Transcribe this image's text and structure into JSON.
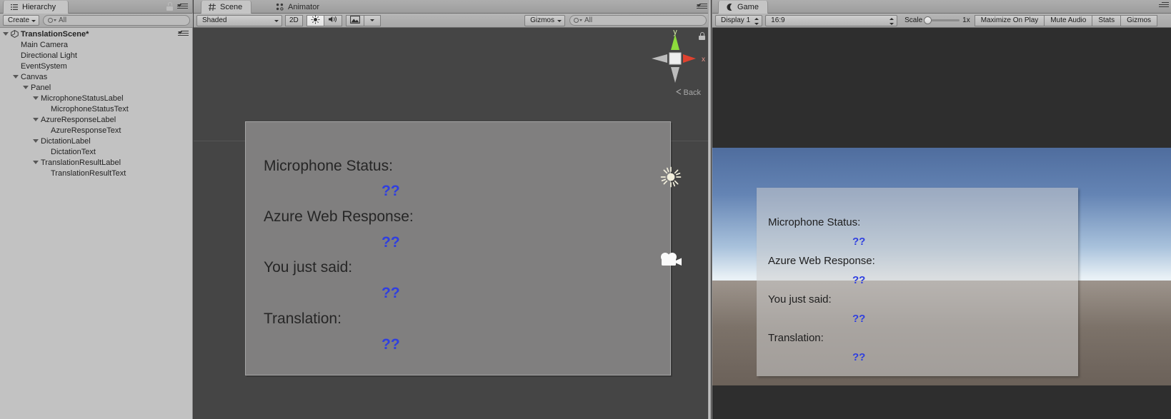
{
  "hierarchy": {
    "tab_label": "Hierarchy",
    "tab_icon": "hierarchy-icon",
    "create_label": "Create",
    "search_placeholder": "All",
    "search_value": "All",
    "scene_root": "TranslationScene*",
    "items": [
      {
        "label": "Main Camera",
        "depth": 1,
        "expandable": false
      },
      {
        "label": "Directional Light",
        "depth": 1,
        "expandable": false
      },
      {
        "label": "EventSystem",
        "depth": 1,
        "expandable": false
      },
      {
        "label": "Canvas",
        "depth": 1,
        "expandable": true
      },
      {
        "label": "Panel",
        "depth": 2,
        "expandable": true
      },
      {
        "label": "MicrophoneStatusLabel",
        "depth": 3,
        "expandable": true
      },
      {
        "label": "MicrophoneStatusText",
        "depth": 4,
        "expandable": false
      },
      {
        "label": "AzureResponseLabel",
        "depth": 3,
        "expandable": true
      },
      {
        "label": "AzureResponseText",
        "depth": 4,
        "expandable": false
      },
      {
        "label": "DictationLabel",
        "depth": 3,
        "expandable": true
      },
      {
        "label": "DictationText",
        "depth": 4,
        "expandable": false
      },
      {
        "label": "TranslationResultLabel",
        "depth": 3,
        "expandable": true
      },
      {
        "label": "TranslationResultText",
        "depth": 4,
        "expandable": false
      }
    ]
  },
  "scene": {
    "tabs": [
      {
        "label": "Scene",
        "active": true,
        "icon": "scene-grid-icon"
      },
      {
        "label": "Animator",
        "active": false,
        "icon": "animator-icon"
      }
    ],
    "toolbar": {
      "shading_mode": "Shaded",
      "mode_2d": "2D",
      "lighting_icon": "sun-icon",
      "audio_icon": "speaker-icon",
      "effects_icon": "image-icon",
      "gizmos_label": "Gizmos",
      "search_placeholder": "All",
      "search_value": "All"
    },
    "axis_gizmo": {
      "y_label": "y",
      "x_label": "x",
      "persp_label": "Back",
      "y_color": "#8ddb3c",
      "x_color": "#e0422f",
      "center_color": "#e8e8e8"
    },
    "panel": {
      "rows": [
        {
          "label": "Microphone Status:",
          "value": "??"
        },
        {
          "label": "Azure Web Response:",
          "value": "??"
        },
        {
          "label": "You just said:",
          "value": "??"
        },
        {
          "label": "Translation:",
          "value": "??"
        }
      ],
      "label_color": "#262626",
      "value_color": "#2f3fe0",
      "background": "#807f7f"
    },
    "gizmos": [
      {
        "name": "directional-light-gizmo",
        "icon": "sun-icon"
      },
      {
        "name": "main-camera-gizmo",
        "icon": "camera-icon"
      }
    ]
  },
  "game": {
    "tab_label": "Game",
    "tab_icon": "game-icon",
    "toolbar": {
      "display": "Display 1",
      "aspect": "16:9",
      "scale_label": "Scale",
      "scale_value": "1x",
      "maximize_on_play": "Maximize On Play",
      "mute_audio": "Mute Audio",
      "stats": "Stats",
      "gizmos": "Gizmos"
    },
    "panel": {
      "rows": [
        {
          "label": "Microphone Status:",
          "value": "??"
        },
        {
          "label": "Azure Web Response:",
          "value": "??"
        },
        {
          "label": "You just said:",
          "value": "??"
        },
        {
          "label": "Translation:",
          "value": "??"
        }
      ],
      "label_color": "#1e1e1e",
      "value_color": "#2f3fe0"
    }
  }
}
